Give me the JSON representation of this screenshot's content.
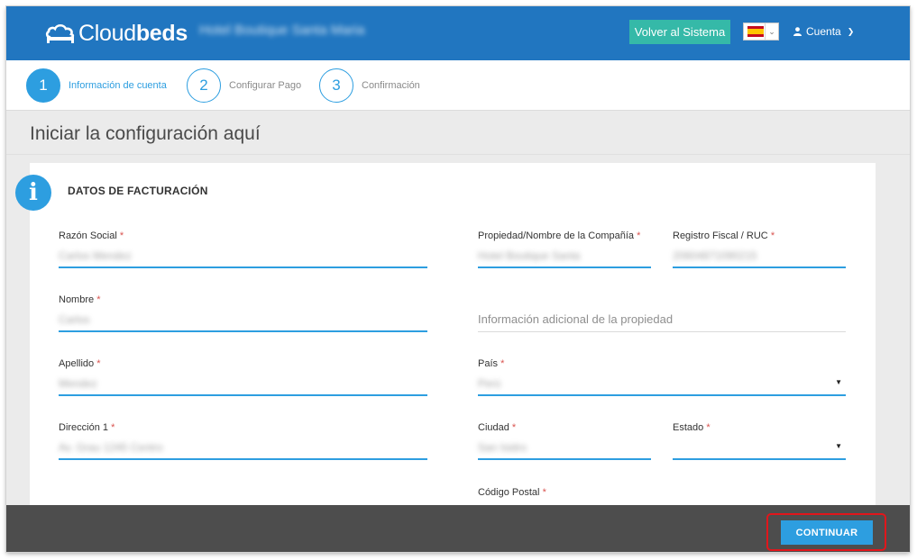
{
  "header": {
    "logo_text_regular": "Cloud",
    "logo_text_bold": "beds",
    "hotel_name": "Hotel Boutique Santa Maria",
    "back_button": "Volver al Sistema",
    "language_flag_icon": "spain-flag-icon",
    "account_label": "Cuenta",
    "accent_color": "#2176c0"
  },
  "wizard": {
    "steps": [
      {
        "number": "1",
        "label": "Información de cuenta",
        "active": true
      },
      {
        "number": "2",
        "label": "Configurar Pago",
        "active": false
      },
      {
        "number": "3",
        "label": "Confirmación",
        "active": false
      }
    ]
  },
  "page": {
    "title": "Iniciar la configuración aquí",
    "section_icon": "info-icon",
    "section_title": "DATOS DE FACTURACIÓN"
  },
  "form": {
    "required_mark": "*",
    "razon_social": {
      "label": "Razón Social",
      "value": "Carlos Mendez"
    },
    "propiedad": {
      "label": "Propiedad/Nombre de la Compañía",
      "value": "Hotel Boutique Santa"
    },
    "registro_fiscal": {
      "label": "Registro Fiscal / RUC",
      "value": "20604871090215"
    },
    "nombre": {
      "label": "Nombre",
      "value": "Carlos"
    },
    "info_adicional": {
      "placeholder": "Información adicional de la propiedad"
    },
    "apellido": {
      "label": "Apellido",
      "value": "Mendez"
    },
    "pais": {
      "label": "País",
      "value": "Perú"
    },
    "direccion1": {
      "label": "Dirección 1",
      "value": "Av. Grau 1245 Centro"
    },
    "ciudad": {
      "label": "Ciudad",
      "value": "San Isidro"
    },
    "estado": {
      "label": "Estado",
      "value": ""
    },
    "codigo_postal": {
      "label": "Código Postal"
    }
  },
  "footer": {
    "continue_button": "CONTINUAR",
    "highlight_color": "#e2161b"
  }
}
